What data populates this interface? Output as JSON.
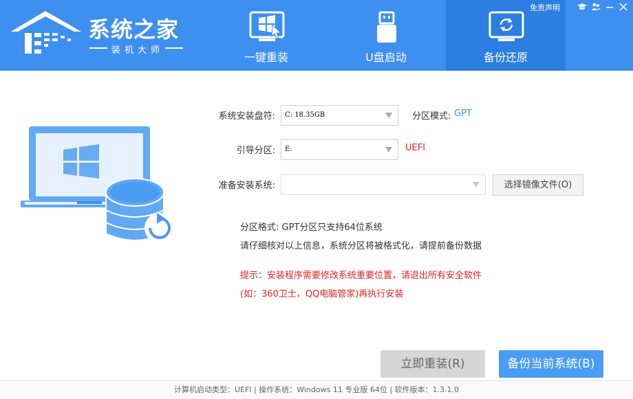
{
  "header": {
    "logo": {
      "title": "系统之家",
      "subtitle": "装机大师"
    },
    "tabs": [
      {
        "label": "一键重装",
        "icon": "windows-cursor-icon",
        "active": false
      },
      {
        "label": "U盘启动",
        "icon": "usb-drive-icon",
        "active": false
      },
      {
        "label": "备份还原",
        "icon": "monitor-restore-icon",
        "active": true
      }
    ],
    "top_links": {
      "disclaimer": "免责声明"
    },
    "window_controls": [
      "graduation-cap-icon",
      "users-icon",
      "minimize-icon",
      "close-icon"
    ],
    "colors": {
      "header_bg": "#3d8ff0",
      "active_tab_bg": "#2c7ee0"
    }
  },
  "form": {
    "install_disk": {
      "label": "系统安装盘符:",
      "value": "C: 18.35GB"
    },
    "partition_mode": {
      "label": "分区模式:",
      "value": "GPT"
    },
    "boot_partition": {
      "label": "引导分区:",
      "value": "E:"
    },
    "boot_mode": "UEFI",
    "prepare_system": {
      "label": "准备安装系统:",
      "value": ""
    },
    "select_image_button": "选择镜像文件(O)"
  },
  "info": {
    "line1": "分区格式: GPT分区只支持64位系统",
    "line2": "请仔细核对以上信息，系统分区将被格式化，请提前备份数据",
    "warning1": "提示：安装程序需要修改系统重要位置，请退出所有安全软件",
    "warning2": "(如：360卫士，QQ电脑管家)再执行安装"
  },
  "actions": {
    "install_now": "立即重装(R)",
    "backup_current": "备份当前系统(B)"
  },
  "status_bar": "计算机启动类型：UEFI | 操作系统：Windows 11 专业版 64位 | 软件版本：1.3.1.0"
}
